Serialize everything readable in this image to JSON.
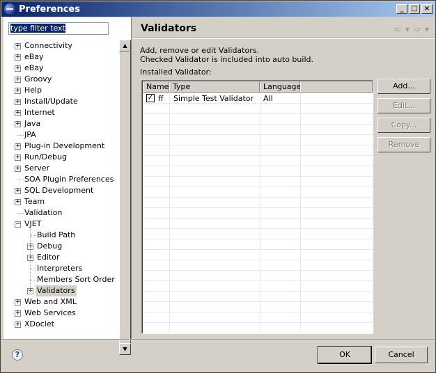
{
  "window": {
    "title": "Preferences",
    "controls": [
      "_",
      "□",
      "×"
    ]
  },
  "filter": {
    "placeholder": "type filter text"
  },
  "tree": [
    {
      "label": "Connectivity",
      "level": 0,
      "expander": "+"
    },
    {
      "label": "eBay",
      "level": 0,
      "expander": "+"
    },
    {
      "label": "eBay",
      "level": 0,
      "expander": "+"
    },
    {
      "label": "Groovy",
      "level": 0,
      "expander": "+"
    },
    {
      "label": "Help",
      "level": 0,
      "expander": "+"
    },
    {
      "label": "Install/Update",
      "level": 0,
      "expander": "+"
    },
    {
      "label": "Internet",
      "level": 0,
      "expander": "+"
    },
    {
      "label": "Java",
      "level": 0,
      "expander": "+"
    },
    {
      "label": "JPA",
      "level": 0,
      "expander": ""
    },
    {
      "label": "Plug-in Development",
      "level": 0,
      "expander": "+"
    },
    {
      "label": "Run/Debug",
      "level": 0,
      "expander": "+"
    },
    {
      "label": "Server",
      "level": 0,
      "expander": "+"
    },
    {
      "label": "SOA Plugin Preferences",
      "level": 0,
      "expander": ""
    },
    {
      "label": "SQL Development",
      "level": 0,
      "expander": "+"
    },
    {
      "label": "Team",
      "level": 0,
      "expander": "+"
    },
    {
      "label": "Validation",
      "level": 0,
      "expander": ""
    },
    {
      "label": "VJET",
      "level": 0,
      "expander": "−"
    },
    {
      "label": "Build Path",
      "level": 1,
      "expander": ""
    },
    {
      "label": "Debug",
      "level": 1,
      "expander": "+"
    },
    {
      "label": "Editor",
      "level": 1,
      "expander": "+"
    },
    {
      "label": "Interpreters",
      "level": 1,
      "expander": ""
    },
    {
      "label": "Members Sort Order",
      "level": 1,
      "expander": ""
    },
    {
      "label": "Validators",
      "level": 1,
      "expander": "+",
      "selected": true
    },
    {
      "label": "Web and XML",
      "level": 0,
      "expander": "+"
    },
    {
      "label": "Web Services",
      "level": 0,
      "expander": "+"
    },
    {
      "label": "XDoclet",
      "level": 0,
      "expander": "+"
    }
  ],
  "page": {
    "title": "Validators",
    "nav_back": "⇦",
    "nav_forward": "⇨",
    "nav_dropdown": "▾",
    "desc_line1": "Add, remove or edit Validators.",
    "desc_line2": "Checked Validator is included into auto build.",
    "installed_label": "Installed Validator:"
  },
  "table": {
    "columns": [
      "Name",
      "Type",
      "Language"
    ],
    "rows": [
      {
        "checked": true,
        "name": "ff",
        "type": "Simple Test Validator",
        "language": "All"
      }
    ]
  },
  "buttons": {
    "add": "Add...",
    "edit": "Edit...",
    "copy": "Copy...",
    "remove": "Remove"
  },
  "footer": {
    "help": "?",
    "ok": "OK",
    "cancel": "Cancel"
  },
  "scrollbar": {
    "up": "▲",
    "down": "▼"
  }
}
